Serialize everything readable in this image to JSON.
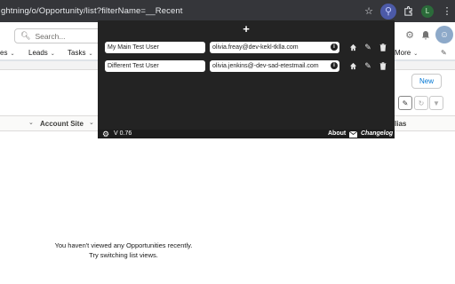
{
  "browser": {
    "url": "ghtning/o/Opportunity/list?filterName=__Recent",
    "icons": [
      "star-icon",
      "extension-icon",
      "puzzle-icon",
      "profile-icon",
      "menu-icon"
    ],
    "profile_initial": "L"
  },
  "header": {
    "search_placeholder": "Search..."
  },
  "nav": {
    "items": [
      {
        "label": "es"
      },
      {
        "label": "Leads"
      },
      {
        "label": "Tasks"
      },
      {
        "label": "More"
      }
    ]
  },
  "list": {
    "new_button": "New",
    "columns": [
      {
        "label": "Account Site"
      },
      {
        "label": "lias"
      }
    ],
    "empty_line1": "You haven't viewed any Opportunities recently.",
    "empty_line2": "Try switching list views."
  },
  "popup": {
    "add_label": "+",
    "users": [
      {
        "name": "My Main Test User",
        "email": "olivia.freay@dev-kekl-tklla.com"
      },
      {
        "name": "Different Test User",
        "email": "olivia.jenkins@-dev-sad-etestmail.com"
      }
    ],
    "version": "V 0.76",
    "about": "About",
    "changelog": "Changelog"
  },
  "colors": {
    "popup_bg": "#232323",
    "chrome_bg": "#35363a",
    "sf_blue": "#0176d3"
  }
}
